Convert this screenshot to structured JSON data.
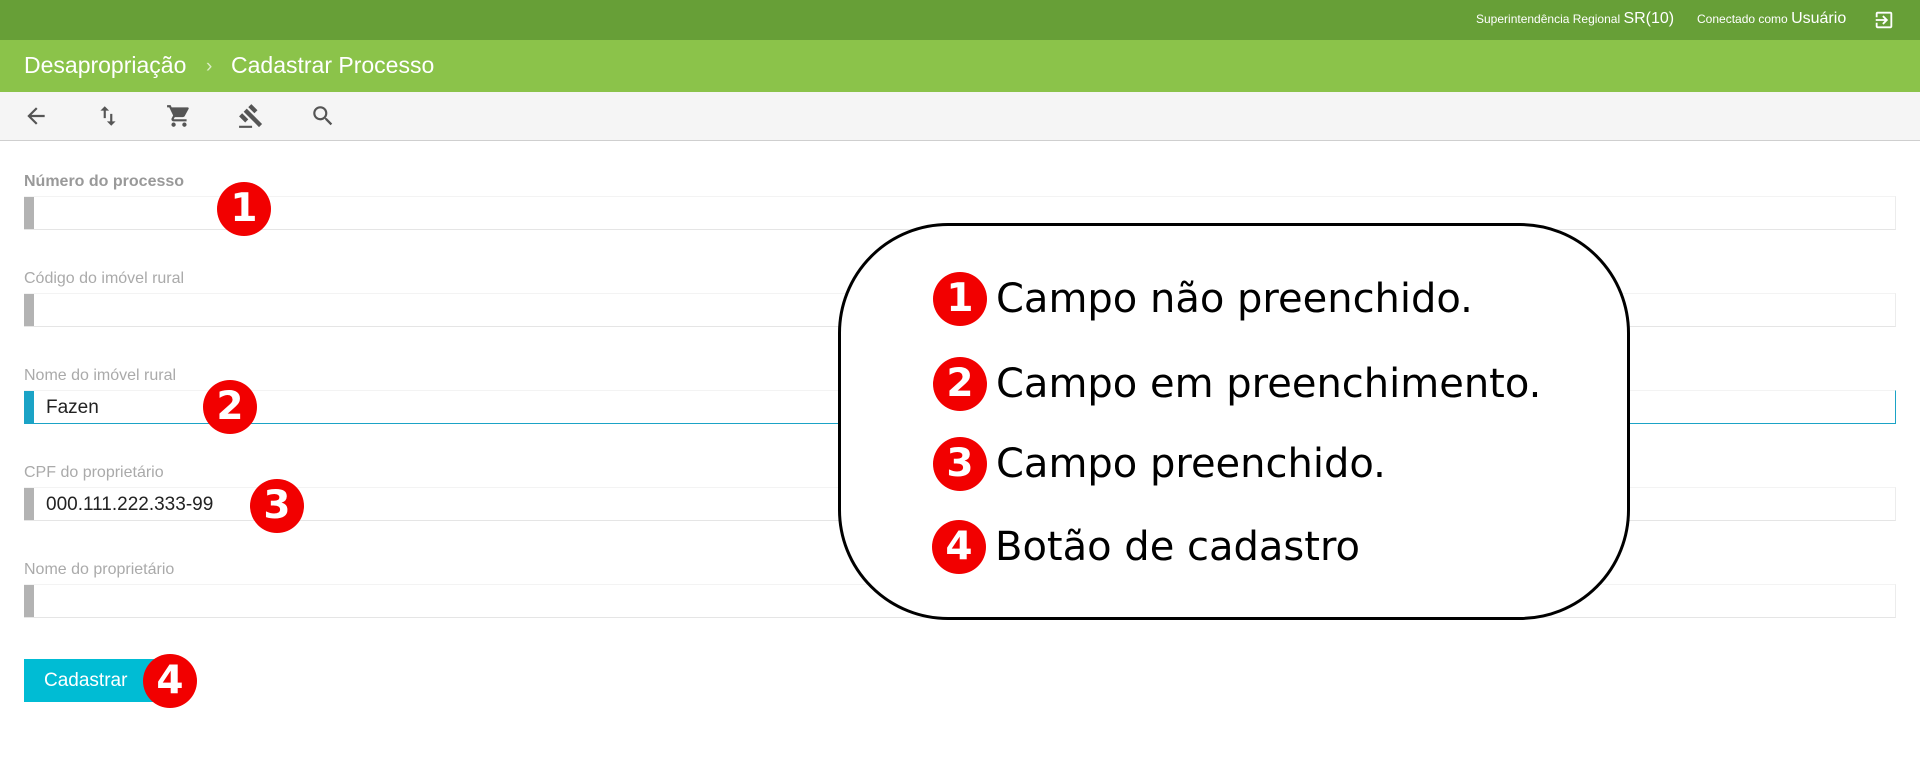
{
  "topbar": {
    "regional_label": "Superintendência Regional",
    "regional_value": "SR(10)",
    "user_label": "Conectado como",
    "user_value": "Usuário",
    "logout_icon": "logout-icon",
    "background": "#679f37"
  },
  "header": {
    "breadcrumb": [
      "Desapropriação",
      "Cadastrar Processo"
    ],
    "separator": "›",
    "background": "#8bc34a"
  },
  "toolbar": {
    "icons": [
      "arrow-back-icon",
      "swap-vert-icon",
      "cart-icon",
      "gavel-icon",
      "search-icon"
    ]
  },
  "form": {
    "fields": [
      {
        "label": "Número do processo",
        "value": ""
      },
      {
        "label": "Código do imóvel rural",
        "value": ""
      },
      {
        "label": "Nome do imóvel rural",
        "value": "Fazen"
      },
      {
        "label": "CPF do proprietário",
        "value": "000.111.222.333-99"
      },
      {
        "label": "Nome do proprietário",
        "value": ""
      }
    ],
    "submit_label": "Cadastrar",
    "accent": "#00bcd4"
  },
  "annotations": {
    "badges": [
      "1",
      "2",
      "3",
      "4"
    ],
    "badge_color": "#f20000",
    "legend": [
      {
        "number": "1",
        "text": "Campo não preenchido."
      },
      {
        "number": "2",
        "text": "Campo em preenchimento."
      },
      {
        "number": "3",
        "text": "Campo preenchido."
      },
      {
        "number": "4",
        "text": "Botão de cadastro"
      }
    ]
  }
}
